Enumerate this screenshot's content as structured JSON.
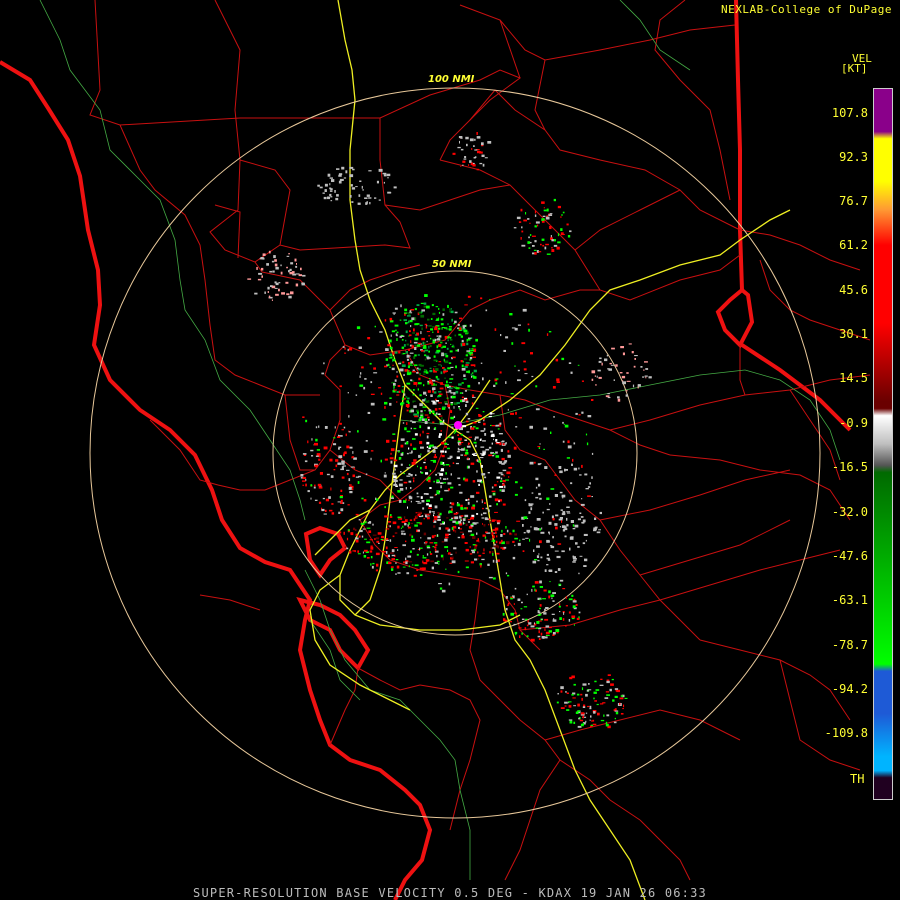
{
  "credit": "NEXLAB-College of DuPage",
  "legend": {
    "title": "VEL",
    "unit": "[KT]",
    "ticks": [
      "107.8",
      "92.3",
      "76.7",
      "61.2",
      "45.6",
      "30.1",
      "14.5",
      "-0.9",
      "-16.5",
      "-32.0",
      "-47.6",
      "-63.1",
      "-78.7",
      "-94.2",
      "-109.8"
    ],
    "bottom_label": "TH",
    "colors": {
      "purple": "#8a008a",
      "yellow": "#ffff00",
      "orange": "#ff9933",
      "red": "#ff0000",
      "dark_red": "#6a0000",
      "gray": "#bfbfbf",
      "dark_green": "#006a00",
      "green": "#00ff00",
      "blue": "#1e5ad6",
      "cyan": "#00b4ff",
      "range_folded": "#200020"
    }
  },
  "rings": [
    {
      "label": "100 NMI"
    },
    {
      "label": "50 NMI"
    }
  ],
  "footer": "SUPER-RESOLUTION BASE VELOCITY 0.5 DEG - KDAX 19 JAN 26 06:33"
}
